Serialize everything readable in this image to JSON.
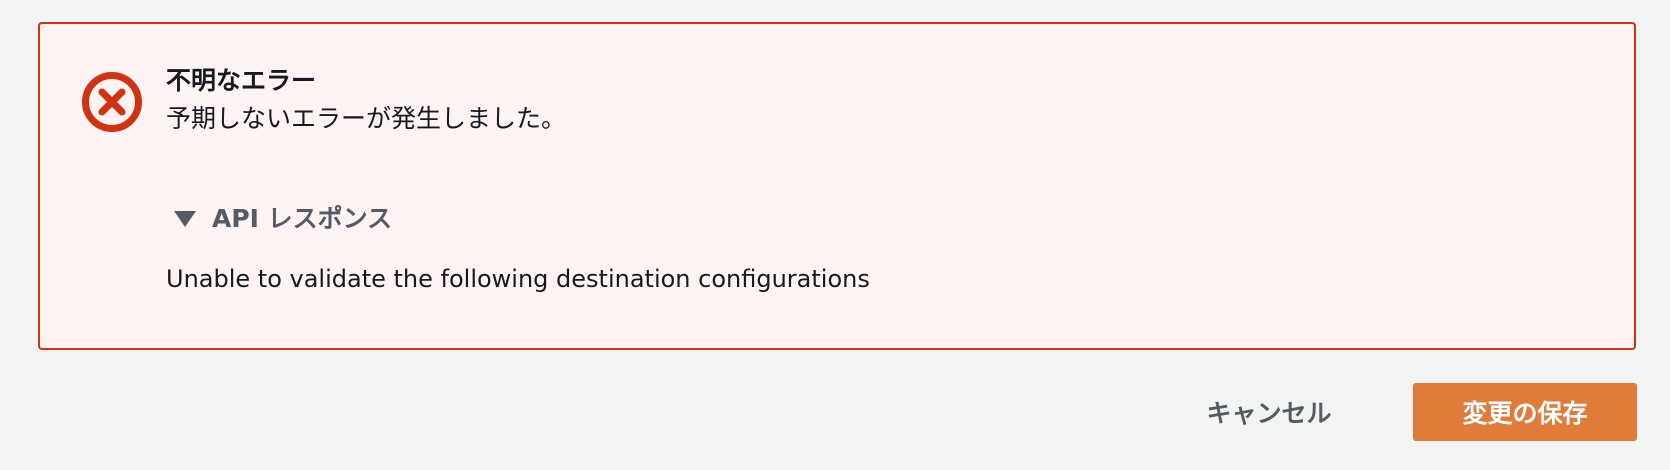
{
  "alert": {
    "type": "error",
    "icon": "error-circle-x-icon",
    "title": "不明なエラー",
    "message": "予期しないエラーが発生しました。",
    "expander": {
      "caret_icon": "caret-down-icon",
      "label": "API レスポンス",
      "expanded": true,
      "content": "Unable to validate the following destination configurations"
    }
  },
  "actions": {
    "cancel_label": "キャンセル",
    "save_label": "変更の保存"
  },
  "colors": {
    "page_background": "#f2f3f3",
    "alert_background": "#fdf3f2",
    "alert_border": "#d13212",
    "error_icon": "#d13212",
    "primary_button": "#e07b39",
    "secondary_text": "#545b64"
  }
}
